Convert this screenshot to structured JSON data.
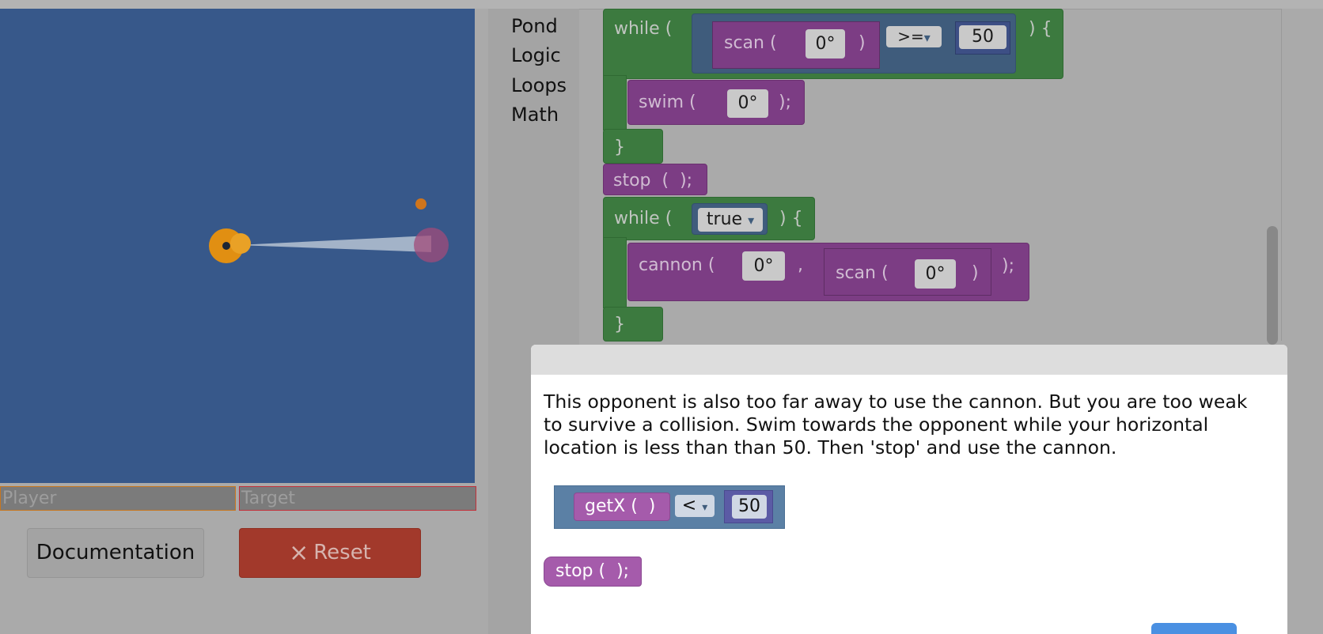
{
  "pond": {
    "player_label": "Player",
    "target_label": "Target",
    "documentation_label": "Documentation",
    "reset_label": "Reset",
    "reset_icon": "×"
  },
  "toolbox": {
    "categories": [
      "Pond",
      "Logic",
      "Loops",
      "Math"
    ]
  },
  "workspace": {
    "while1": {
      "keyword": "while (",
      "scan": "scan (",
      "scan_close": ")",
      "scan_angle": "0°",
      "operator": ">=",
      "operator_arrow": "▾",
      "value": "50",
      "close": ") {"
    },
    "swim": {
      "label": "swim (",
      "angle": "0°",
      "close": ");"
    },
    "brace1": "}",
    "stop": {
      "label": "stop  (  );"
    },
    "while2": {
      "keyword": "while (",
      "condition": "true",
      "condition_arrow": "▾",
      "close": ") {"
    },
    "cannon": {
      "label": "cannon (",
      "angle": "0°",
      "comma": ",",
      "scan": "scan (",
      "scan_angle": "0°",
      "scan_close": ")",
      "close": ");"
    },
    "brace2": "}"
  },
  "dialog": {
    "text": "This opponent is also too far away to use the cannon. But you are too weak to survive a collision. Swim towards the opponent while your horizontal location is less than than 50. Then 'stop' and use the cannon.",
    "getx_label": "getX (  )",
    "getx_operator": "<",
    "getx_arrow": "▾",
    "getx_value": "50",
    "stop_label": "stop (  );"
  },
  "colors": {
    "pond": "#37588a",
    "loops": "#3c7a3f",
    "pond_blocks": "#7c3d84",
    "logic": "#3f5c7c",
    "reset": "#a2392b"
  }
}
